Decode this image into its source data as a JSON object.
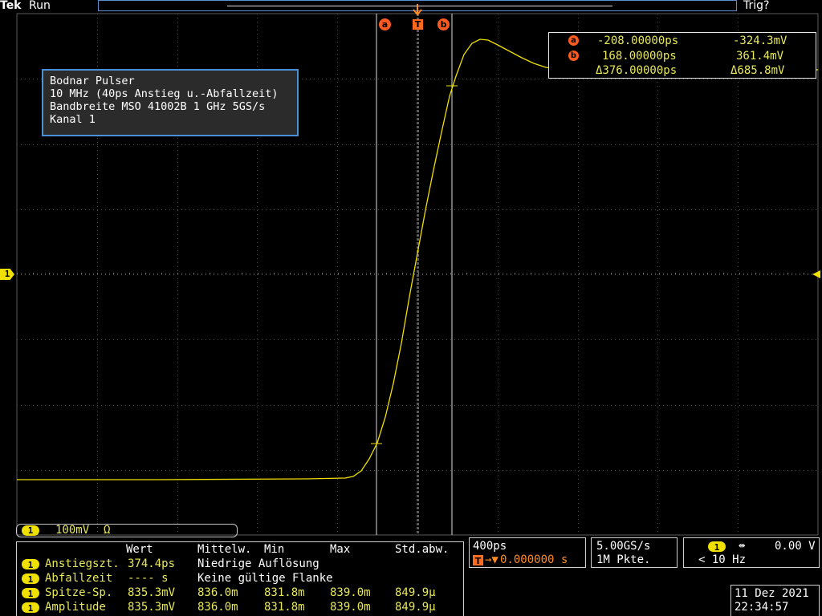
{
  "header": {
    "brand": "Tek",
    "status": "Run",
    "trigger_status": "Trig?"
  },
  "cursor_markers": {
    "a": "a",
    "b": "b",
    "trigger": "T"
  },
  "annotation": {
    "lines": [
      "Bodnar Pulser",
      "10 MHz  (40ps  Anstieg u.-Abfallzeit)",
      "Bandbreite MSO 41002B  1 GHz 5GS/s",
      "Kanal 1"
    ]
  },
  "cursor_readout": {
    "a_time": "-208.00000ps",
    "a_volt": "-324.3mV",
    "b_time": "168.00000ps",
    "b_volt": "361.4mV",
    "delta_time": "Δ376.00000ps",
    "delta_volt": "Δ685.8mV"
  },
  "channel": {
    "label": "1",
    "scale": "100mV",
    "impedance": "Ω"
  },
  "measurements": {
    "headers": [
      "Wert",
      "Mittelw.",
      "Min",
      "Max",
      "Std.abw."
    ],
    "rows": [
      {
        "name": "Anstiegszt.",
        "wert": "374.4ps",
        "note": "Niedrige Auflösung"
      },
      {
        "name": "Abfallzeit",
        "wert": "---- s",
        "note": "Keine gültige Flanke"
      },
      {
        "name": "Spitze-Sp.",
        "wert": "835.3mV",
        "mean": "836.0m",
        "min": "831.8m",
        "max": "839.0m",
        "std": "849.9µ"
      },
      {
        "name": "Amplitude",
        "wert": "835.3mV",
        "mean": "836.0m",
        "min": "831.8m",
        "max": "839.0m",
        "std": "849.9µ"
      }
    ]
  },
  "timebase": {
    "scale": "400ps",
    "position": "0.000000 s"
  },
  "acquisition": {
    "rate": "5.00GS/s",
    "record": "1M Pkte."
  },
  "trigger": {
    "level": "0.00 V",
    "frequency": "< 10 Hz"
  },
  "datetime": {
    "date": "11 Dez  2021",
    "time": "22:34:57"
  },
  "colors": {
    "ch1": "#f0e000",
    "cursor": "#ff5a1f",
    "border": "#4d8fd6"
  }
}
